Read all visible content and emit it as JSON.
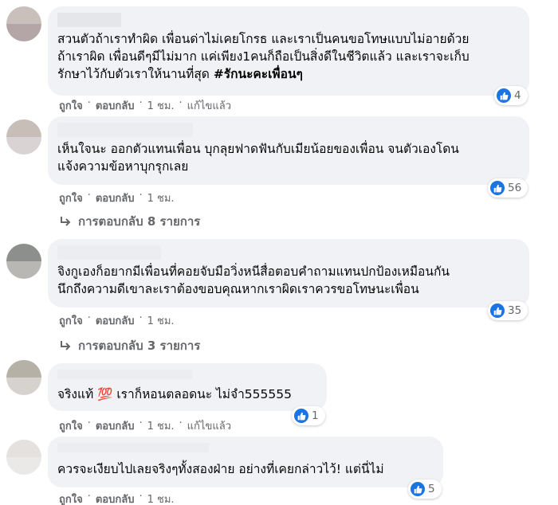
{
  "comments": [
    {
      "text_lines": [
        "สวนตัวถ้าเราทำผิด เพื่อนด่าไม่เคยโกรธ และเราเป็นคนขอโทษแบบไม่อายด้วย",
        "ถ้าเราผิด เพื่อนดีๆมีไม่มาก แค่เพียง1คนก็ถือเป็นสิ่งดีในชีวิตแล้ว และเราจะเก็บ",
        "รักษาไว้กับตัวเราให้นานที่สุด "
      ],
      "hashtag": "#รักนะคะเพื่อนๆ",
      "reaction_count": "4",
      "like": "ถูกใจ",
      "reply": "ตอบกลับ",
      "time": "1 ชม.",
      "edited": "แก้ไขแล้ว"
    },
    {
      "text_lines": [
        "เห็นใจนะ ออกตัวแทนเพื่อน บุกลุยฟาดฟันกับเมียน้อยของเพื่อน จนตัวเองโดน",
        "แจ้งความข้อหาบุกรุกเลย"
      ],
      "reaction_count": "56",
      "like": "ถูกใจ",
      "reply": "ตอบกลับ",
      "time": "1 ชม.",
      "replies_label": "การตอบกลับ 8 รายการ"
    },
    {
      "text_lines": [
        "จิงกูเองก็อยากมีเพื่อนที่คอยจับมือวิ่งหนีสื่อตอบคำถามแทนปกป้องเหมือนกัน",
        "นึกถึงความดีเขาละเราต้องขอบคุณหากเราผิดเราควรขอโทษนะเพื่อน"
      ],
      "reaction_count": "35",
      "like": "ถูกใจ",
      "reply": "ตอบกลับ",
      "time": "1 ชม.",
      "replies_label": "การตอบกลับ 3 รายการ"
    },
    {
      "text_before": "จริงแท้ ",
      "emoji": "💯",
      "text_after": " เราก็หอนตลอดนะ ไม่จำ555555",
      "reaction_count": "1",
      "like": "ถูกใจ",
      "reply": "ตอบกลับ",
      "time": "1 ชม.",
      "edited": "แก้ไขแล้ว"
    },
    {
      "text_lines": [
        "ควรจะเงียบไปเลยจริงๆทั้งสองฝ่าย อย่างที่เคยกล่าวไว้! แต่นี่ไม่"
      ],
      "reaction_count": "5",
      "like": "ถูกใจ",
      "reply": "ตอบกลับ",
      "time": "1 ชม."
    }
  ],
  "colors": {
    "bubble": "#f0f2f5",
    "meta_text": "#65676b",
    "like_blue": "#1b74e4"
  },
  "icons": [
    "like-icon",
    "reply-arrow-icon"
  ]
}
